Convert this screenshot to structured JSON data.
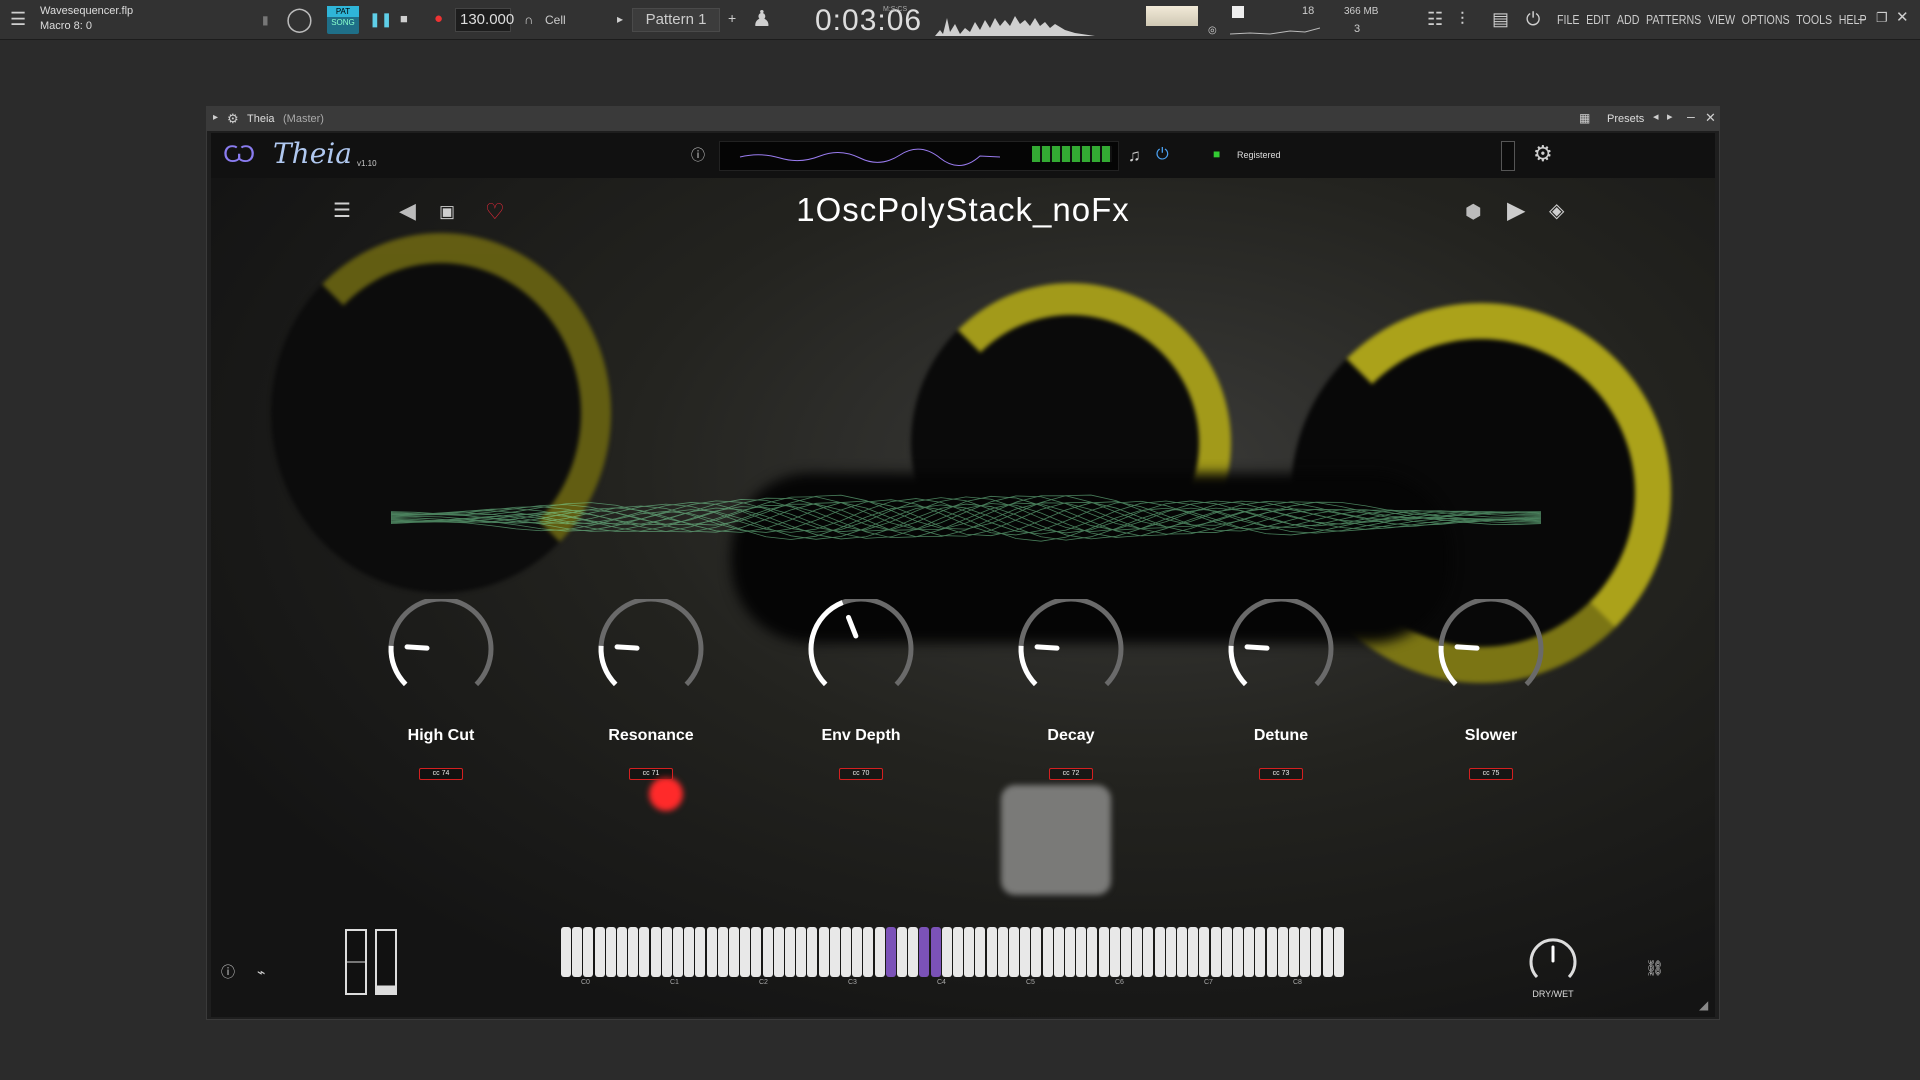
{
  "daw": {
    "file_name": "Wavesequencer.flp",
    "macro": "Macro 8: 0",
    "pat_label": "PAT",
    "song_label": "SONG",
    "tempo": "130.000",
    "snap": "Cell",
    "pattern": "Pattern 1",
    "time": "0:03:06",
    "time_unit": "M:S:CS",
    "cpu": "18",
    "memory": "366 MB",
    "voices": "3",
    "menu": [
      "FILE",
      "EDIT",
      "ADD",
      "PATTERNS",
      "VIEW",
      "OPTIONS",
      "TOOLS",
      "HELP"
    ]
  },
  "window": {
    "title": "Theia",
    "subtitle": "(Master)",
    "presets_label": "Presets"
  },
  "plugin": {
    "logo_text": "Theia",
    "version": "v1.10",
    "registered": "Registered",
    "preset_name": "1OscPolyStack_noFx",
    "dry_wet_label": "DRY/WET",
    "knobs": [
      {
        "label": "High Cut",
        "cc": "cc  74",
        "value": 0.18
      },
      {
        "label": "Resonance",
        "cc": "cc  71",
        "value": 0.18
      },
      {
        "label": "Env Depth",
        "cc": "cc  70",
        "value": 0.42
      },
      {
        "label": "Decay",
        "cc": "cc  72",
        "value": 0.18
      },
      {
        "label": "Detune",
        "cc": "cc  73",
        "value": 0.18
      },
      {
        "label": "Slower",
        "cc": "cc  75",
        "value": 0.18
      }
    ],
    "octave_labels": [
      "C0",
      "C1",
      "C2",
      "C3",
      "C4",
      "C5",
      "C6",
      "C7",
      "C8"
    ],
    "highlight_color": "#7b52b8",
    "cc_color": "#d42020"
  }
}
